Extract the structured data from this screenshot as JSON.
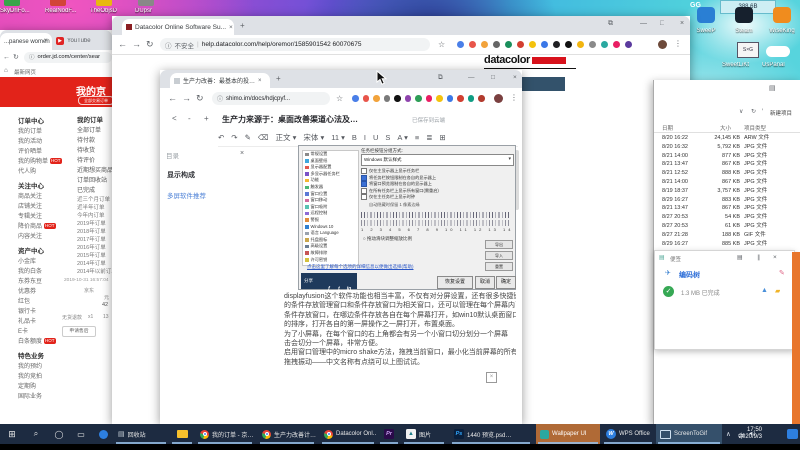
{
  "glyphs": {
    "back": "←",
    "fwd": "→",
    "reload": "↻",
    "close": "×",
    "min": "—",
    "max": "□",
    "more": "⋮",
    "star": "☆",
    "home": "⌂",
    "info": "ⓘ",
    "plus": "+",
    "caret": "∧",
    "search": "⌕",
    "cortana": "◯",
    "taskview": "▭",
    "start": "⊞",
    "cast": "⧉",
    "menu": "▤",
    "play": "▶",
    "speaker": "◄)",
    "dropdown": "▾",
    "check": "✓",
    "lt": "<",
    "dash": "-",
    "pen": "✎",
    "undo": "↶",
    "redo": "↷",
    "bar": "∥",
    "plane": "✈",
    "mountain": "▲",
    "folder": "▰",
    "slash": "⁄",
    "down": "∨",
    "imgbox": "×"
  },
  "desktop": {
    "tooltip_text": "388.6B",
    "gg_text": "GG",
    "icons_tl": [
      "SkyDriFo...",
      "RealNodF...",
      "TheObjsD",
      "DUpsr"
    ],
    "icons_tr": [
      {
        "label": "SweeP",
        "c": "#2a7fd4"
      },
      {
        "label": "Steam",
        "c": "#16202d"
      },
      {
        "label": "WiseKing",
        "c": "#f08c1e"
      }
    ],
    "tv_text": "S×G",
    "icons_r2": [
      {
        "label": "SweetLiKt"
      },
      {
        "label": "UsPanal"
      }
    ]
  },
  "jd": {
    "tab1": "...panese women",
    "tab2": "YouTube",
    "url": "order.jd.com/center/sear",
    "bookmark": "最新网页",
    "banner": "我的京",
    "banner_pill": "全部交易订单",
    "nav": [
      {
        "label": "订单中心",
        "cls": "hd"
      },
      {
        "label": "我的订单"
      },
      {
        "label": "我的活动"
      },
      {
        "label": "评价晒单"
      },
      {
        "label": "我的购物单",
        "hot": "HOT"
      },
      {
        "label": "代人购"
      },
      {
        "label": "关注中心",
        "cls": "hd"
      },
      {
        "label": "商品关注"
      },
      {
        "label": "店铺关注"
      },
      {
        "label": "专辑关注"
      },
      {
        "label": "降价商品",
        "hot": "HOT"
      },
      {
        "label": "内容关注"
      },
      {
        "label": "资产中心",
        "cls": "hd"
      },
      {
        "label": "小金库"
      },
      {
        "label": "我的白条"
      },
      {
        "label": "东券东豆"
      },
      {
        "label": "优惠券"
      },
      {
        "label": "红包"
      },
      {
        "label": "银行卡"
      },
      {
        "label": "礼品卡"
      },
      {
        "label": "E卡"
      },
      {
        "label": "白条额度",
        "hot": "HOT"
      },
      {
        "label": "特色业务",
        "cls": "hd"
      },
      {
        "label": "我的预约"
      },
      {
        "label": "我的竞拍"
      },
      {
        "label": "定期购"
      },
      {
        "label": "国际业务"
      }
    ],
    "orders_title": "我的订单",
    "order_links": [
      "全部订单",
      "待付款",
      "待收货",
      "待评价",
      "近期想买商品",
      "订单回收站",
      "已完成"
    ],
    "year_links": [
      "近三个月订单",
      "近半年订单",
      "今年内订单",
      "2019年订单",
      "2018年订单",
      "2017年订单",
      "2016年订单",
      "2015年订单",
      "2014年订单",
      "2014年以前订单"
    ],
    "order_meta": "2019-10-31 16:57:04",
    "order_store": "京东",
    "bits": {
      "cur": "元",
      "price": "42",
      "status": "无货退款",
      "qty": "x1",
      "num": "13",
      "after_sale": "申请售后"
    }
  },
  "dc": {
    "tab": "Datacolor Online Software Su...",
    "security": "不安全",
    "url": "help.datacolor.com/help/oremor/1585901542 60070675",
    "logo": "datacolor",
    "ext_dots": [
      "#4a7fe8",
      "#e8554a",
      "#f2a33c",
      "#666666",
      "#1a8f5c",
      "#d23f31",
      "#f4c20d",
      "#3b78e7",
      "#202124",
      "#111111",
      "#f2b50f",
      "#8a8a8a",
      "#2aa8a0",
      "#e91e63",
      "#5b3a9e"
    ]
  },
  "explorer": {
    "col_date": "日期",
    "col_size": "大小",
    "col_type": "项目类型",
    "tool_hint": "新建项目",
    "rows": [
      {
        "date": "8/20 16:22",
        "size": "24,145 KB",
        "type": "ARW 文件"
      },
      {
        "date": "8/20 16:32",
        "size": "5,792 KB",
        "type": "JPG 文件"
      },
      {
        "date": "8/21 14:00",
        "size": "877 KB",
        "type": "JPG 文件"
      },
      {
        "date": "8/21 13:47",
        "size": "867 KB",
        "type": "JPG 文件"
      },
      {
        "date": "8/21 12:52",
        "size": "888 KB",
        "type": "JPG 文件"
      },
      {
        "date": "8/21 14:00",
        "size": "867 KB",
        "type": "JPG 文件"
      },
      {
        "date": "8/19 18:37",
        "size": "3,757 KB",
        "type": "JPG 文件"
      },
      {
        "date": "8/29 16:27",
        "size": "883 KB",
        "type": "JPG 文件"
      },
      {
        "date": "8/21 13:47",
        "size": "867 KB",
        "type": "JPG 文件"
      },
      {
        "date": "8/27 20:53",
        "size": "54 KB",
        "type": "JPG 文件"
      },
      {
        "date": "8/27 20:53",
        "size": "61 KB",
        "type": "JPG 文件"
      },
      {
        "date": "8/27 21:28",
        "size": "188 KB",
        "type": "GIF 文件"
      },
      {
        "date": "8/29 16:27",
        "size": "885 KB",
        "type": "JPG 文件"
      }
    ]
  },
  "popup": {
    "title": "便签",
    "item1": "编码树",
    "item2": "1.3 MB 已完成"
  },
  "shimo": {
    "tab": "生产力改善：最基本的投…",
    "url": "shimo.im/docs/hdjcpyf...",
    "doc_title": "生产力来源于：桌面改善渠道心法及…",
    "saved": "已保存到云端",
    "outline": {
      "toc": "目录",
      "item_bold": "显示构成",
      "item_link": "多屏软件推荐"
    },
    "fmt": [
      "↶",
      "↷",
      "✎",
      "⌫",
      "正文 ▾",
      "宋体 ▾",
      "11 ▾",
      "B",
      "I",
      "U",
      "S",
      "A ▾",
      "≡",
      "≣",
      "⊞"
    ],
    "ext_dots": [
      "#4a7fe8",
      "#e8554a",
      "#f2a33c",
      "#7a7a7a",
      "#111111",
      "#8e44ad",
      "#2e9e57",
      "#e91e63",
      "#f4c20d",
      "#3b78e7",
      "#d23f31",
      "#0f9d83",
      "#b23b2e"
    ],
    "dialog": {
      "top_label": "任务栏按钮分组方式:",
      "dropdown": "Windows 默认样式",
      "list": [
        {
          "label": "常规设置",
          "c": "#8a8a8a"
        },
        {
          "label": "桌面壁纸",
          "c": "#3fa7dd"
        },
        {
          "label": "显示器配置",
          "c": "#e2574c"
        },
        {
          "label": "多显示器任务栏",
          "c": "#7a52c7"
        },
        {
          "label": "功能",
          "c": "#f2b632"
        },
        {
          "label": "触发器",
          "c": "#49b675"
        },
        {
          "label": "窗口位置",
          "c": "#5b78d6"
        },
        {
          "label": "窗口移动",
          "c": "#d2699e"
        },
        {
          "label": "窗口吸附",
          "c": "#58c2b2"
        },
        {
          "label": "远程控制",
          "c": "#8d6ad6"
        },
        {
          "label": "警报",
          "c": "#e08b3a"
        },
        {
          "label": "Windows 10",
          "c": "#2f7fd0"
        },
        {
          "label": "语言 Language",
          "c": "#9aa2ad"
        },
        {
          "label": "托盘图标",
          "c": "#caa64b"
        },
        {
          "label": "高级设置",
          "c": "#6b7d92"
        },
        {
          "label": "故障排除",
          "c": "#c75454"
        },
        {
          "label": "许可密钥",
          "c": "#d4c13e"
        }
      ],
      "checks": [
        {
          "on": "",
          "label": "仅在主显示器上显示任务栏"
        },
        {
          "on": "on",
          "label": "将任务栏按钮限制在各自的显示器上"
        },
        {
          "on": "on",
          "label": "将窗口预览限制在各自的显示器上"
        },
        {
          "on": "",
          "label": "在所有任务栏上显示所有窗口(需重启)"
        },
        {
          "on": "",
          "label": "仅在主任务栏上显示时钟"
        }
      ],
      "subnote": "自动隐藏时保留 1 像素边缘",
      "ruler_nums": "1 2 3 4 5 6 7 8 9 10 11 12 13 14 15",
      "note": "○ 拖动滑块调整缩放比例",
      "side_buttons": [
        "导出",
        "导入",
        "重置"
      ],
      "link": "点击这里了解每个选项的详细信息以便做出选择(帮助)",
      "share": "分享",
      "social": [
        "f",
        "t",
        "in"
      ],
      "buttons": [
        "恢复设置",
        "取消",
        "确定"
      ]
    },
    "paragraphs": [
      "displayfusion这个软件功能也相当丰富，不仅有对分屏设置，还有很多快捷键功能",
      "的条件存放管理窗口和条件存放窗口为相关窗口，还可以管理在每个屏幕内已分别",
      "条件存放窗口，在哪边条件存放各自在每个屏幕打开，如win10默认桌面窗口",
      "的排序，打开各自的第一屏操作之一屏打开，布置桌面。",
      "为了小屏幕，在每个窗口的右上角都会有另一个小窗口切分划分一个屏幕　　…点",
      "击会切分一个屏幕，非常方便。",
      "启用窗口管理中的micro shake方法，拖拽当前窗口，最小化当前屏幕的所有其他窗口",
      "拖拽振动——中文名称有点绕可以上图试试。"
    ]
  },
  "taskbar": {
    "recycle": "回收站",
    "chrome1": "我的订单 - 京…",
    "chrome2": "生产力改善计…",
    "chrome3": "Datacolor Onl…",
    "pr": "Pr",
    "photo_label": "图片",
    "ps": "Ps",
    "ps_label": "1440 预览.psd…",
    "wallpaper": "Wallpaper UI",
    "wps": "W",
    "wps_label": "WPS Office",
    "stg_label": "ScreenToGif",
    "ime": "中",
    "time": "17:50",
    "date": "2020/9/3"
  }
}
